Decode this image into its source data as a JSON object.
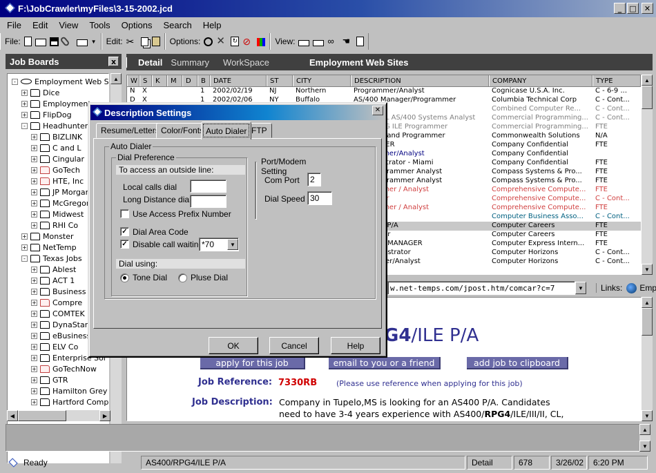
{
  "window": {
    "title": "F:\\JobCrawler\\myFiles\\3-15-2002.jcd"
  },
  "menu": [
    "File",
    "Edit",
    "View",
    "Tools",
    "Options",
    "Search",
    "Help"
  ],
  "toolbar": {
    "file_label": "File:",
    "edit_label": "Edit:",
    "options_label": "Options:",
    "view_label": "View:"
  },
  "left": {
    "title": "Job Boards",
    "close": "x",
    "tree": [
      {
        "label": "Employment Web Sites",
        "level": 0,
        "expand": "-",
        "kind": "root"
      },
      {
        "label": "Dice",
        "level": 1,
        "expand": "+"
      },
      {
        "label": "Employment",
        "level": 1,
        "expand": "+"
      },
      {
        "label": "FlipDog",
        "level": 1,
        "expand": "+"
      },
      {
        "label": "Headhunter",
        "level": 1,
        "expand": "-"
      },
      {
        "label": "BIZLINK",
        "level": 2,
        "expand": "+"
      },
      {
        "label": "C and L",
        "level": 2,
        "expand": "+"
      },
      {
        "label": "Cingular",
        "level": 2,
        "expand": "+"
      },
      {
        "label": "GoTech",
        "level": 2,
        "expand": "+",
        "red": true
      },
      {
        "label": "HTE, Inc",
        "level": 2,
        "expand": "+",
        "red": true
      },
      {
        "label": "JP Morgan",
        "level": 2,
        "expand": "+"
      },
      {
        "label": "McGregor",
        "level": 2,
        "expand": "+"
      },
      {
        "label": "Midwest",
        "level": 2,
        "expand": "+"
      },
      {
        "label": "RHI Co",
        "level": 2,
        "expand": "+"
      },
      {
        "label": "Monster",
        "level": 1,
        "expand": "+"
      },
      {
        "label": "NetTemp",
        "level": 1,
        "expand": "+"
      },
      {
        "label": "Texas Jobs",
        "level": 1,
        "expand": "-"
      },
      {
        "label": "Ablest",
        "level": 2,
        "expand": "+"
      },
      {
        "label": "ACT 1",
        "level": 2,
        "expand": "+"
      },
      {
        "label": "Business",
        "level": 2,
        "expand": "+"
      },
      {
        "label": "Compre",
        "level": 2,
        "expand": "+",
        "red": true
      },
      {
        "label": "COMTEK",
        "level": 2,
        "expand": "+"
      },
      {
        "label": "DynaStar",
        "level": 2,
        "expand": "+"
      },
      {
        "label": "eBusiness",
        "level": 2,
        "expand": "+"
      },
      {
        "label": "ELV Co",
        "level": 2,
        "expand": "+"
      },
      {
        "label": "Enterprise Sol",
        "level": 2,
        "expand": "+"
      },
      {
        "label": "GoTechNow",
        "level": 2,
        "expand": "+",
        "red": true
      },
      {
        "label": "GTR",
        "level": 2,
        "expand": "+"
      },
      {
        "label": "Hamilton Grey",
        "level": 2,
        "expand": "+"
      },
      {
        "label": "Hartford Comp",
        "level": 2,
        "expand": "+"
      }
    ]
  },
  "tabs": {
    "detail": "Detail",
    "summary": "Summary",
    "workspace": "WorkSpace",
    "caption": "Employment Web Sites"
  },
  "grid": {
    "columns": [
      "W",
      "S",
      "K",
      "M",
      "D",
      "B",
      "DATE",
      "ST",
      "CITY",
      "DESCRIPTION",
      "COMPANY",
      "TYPE"
    ],
    "rows": [
      {
        "w": "N",
        "s": "X",
        "b": "1",
        "date": "2002/02/19",
        "st": "NJ",
        "city": "Northern",
        "desc": "Programmer/Analyst",
        "company": "Cognicase U.S.A. Inc.",
        "type": "C - 6-9 ..."
      },
      {
        "w": "D",
        "s": "X",
        "b": "1",
        "date": "2002/02/06",
        "st": "NY",
        "city": "Buffalo",
        "desc": "AS/400 Manager/Programmer",
        "company": "Columbia Technical Corp",
        "type": "C - Cont..."
      },
      {
        "desc": "rammer",
        "company": "Combined Computer Re...",
        "type": "C - Cont...",
        "gray": true
      },
      {
        "desc": "RPGILE/CL AS/400 Systems Analyst",
        "company": "Commercial Programming...",
        "type": "C - Cont...",
        "gray": true
      },
      {
        "desc": "S/400 RPG ILE Programmer",
        "company": "Commercial Programming...",
        "type": "FTE",
        "gray": true
      },
      {
        "desc": "rammers and Programmer",
        "company": "Commonwealth Solutions",
        "type": "N/A"
      },
      {
        "desc": "OGRAMMER",
        "company": "Company Confidential",
        "type": "FTE"
      },
      {
        "desc": "Programmer/Analyst",
        "company": "Company Confidential",
        "type": "",
        "blue": true
      },
      {
        "desc": "r Administrator - Miami",
        "company": "Company Confidential",
        "type": "FTE"
      },
      {
        "desc": "/400 Programmer Analyst",
        "company": "Compass Systems & Pro...",
        "type": "FTE"
      },
      {
        "desc": "/400 Programmer Analyst",
        "company": "Compass Systems & Pro...",
        "type": "FTE"
      },
      {
        "desc": "Programmer / Analyst",
        "company": "Comprehensive Compute...",
        "type": "FTE",
        "red": true
      },
      {
        "desc": "Developer",
        "company": "Comprehensive Compute...",
        "type": "C - Cont...",
        "red": true
      },
      {
        "desc": "Programmer / Analyst",
        "company": "Comprehensive Compute...",
        "type": "FTE",
        "red": true
      },
      {
        "desc": "n Lead",
        "company": "Computer Business Asso...",
        "type": "C - Cont...",
        "teal": true
      },
      {
        "desc": "RPG4/ILE P/A",
        "company": "Computer Careers",
        "type": "FTE",
        "selected": true
      },
      {
        "desc": "S Manager",
        "company": "Computer Careers",
        "type": "FTE"
      },
      {
        "desc": "SUPPORT MANAGER",
        "company": "Computer Express Intern...",
        "type": "FTE"
      },
      {
        "desc": "se Administrator",
        "company": "Computer Horizons",
        "type": "C - Cont..."
      },
      {
        "desc": "rogrammer/Analyst",
        "company": "Computer Horizons",
        "type": "C - Cont..."
      }
    ]
  },
  "address": {
    "url": "w.net-temps.com/jpost.htm/comcar?c=7",
    "links_label": "Links:",
    "links_item": "Emplo"
  },
  "page": {
    "heading_bold": "G4",
    "heading_rest": "/ILE P/A",
    "apply": "apply for this job",
    "email": "email to you or a friend",
    "clipboard": "add job to clipboard",
    "ref_label": "Job Reference:",
    "ref_value": "7330RB",
    "ref_note": "(Please use reference when applying for this job)",
    "desc_label": "Job Description:",
    "desc_line1": "Company in Tupelo,MS is looking for an AS400 P/A. Candidates",
    "desc_line2_a": "need to have 3-4 years experience with AS400/",
    "desc_line2_b": "RPG4",
    "desc_line2_c": "/ILE/III/II, CL,"
  },
  "status": {
    "ready": "Ready",
    "item": "AS400/RPG4/ILE P/A",
    "view": "Detail",
    "count": "678",
    "date": "3/26/02",
    "time": "6:20 PM"
  },
  "dialog": {
    "title": "Description Settings",
    "close": "✕",
    "tabs": [
      "Resume/Letters",
      "Color/Fonts",
      "Auto Dialer",
      "FTP"
    ],
    "group_auto": "Auto Dialer",
    "group_pref": "Dial Preference",
    "outside_line": "To access an outside line:",
    "local_label": "Local calls dial",
    "local_value": "",
    "long_label": "Long Distance dial",
    "long_value": "",
    "prefix_label": "Use Access Prefix Number",
    "prefix_checked": false,
    "area_label": "Dial Area Code",
    "area_checked": true,
    "waiting_label": "Disable call waiting",
    "waiting_checked": true,
    "waiting_value": "*70",
    "dial_using": "Dial using:",
    "tone": "Tone Dial",
    "pulse": "Pluse Dial",
    "group_port": "Port/Modem  Setting",
    "com_label": "Com Port",
    "com_value": "2",
    "speed_label": "Dial Speed",
    "speed_value": "30",
    "ok": "OK",
    "cancel": "Cancel",
    "help": "Help"
  }
}
